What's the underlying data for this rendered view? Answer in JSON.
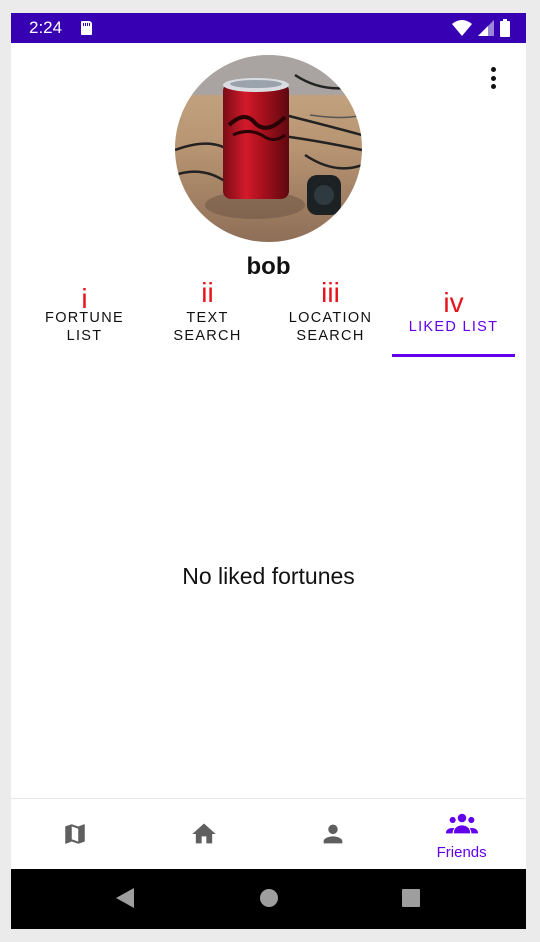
{
  "status_bar": {
    "time": "2:24",
    "icons": [
      "sd-card-icon",
      "wifi-icon",
      "signal-icon",
      "battery-icon"
    ],
    "background": "#3700b3"
  },
  "header": {
    "menu_icon": "more-vert-icon"
  },
  "profile": {
    "name": "bob",
    "avatar": "profile photo of a red soda can on a table"
  },
  "tabs": [
    {
      "marker": "i",
      "label": "FORTUNE\nLIST",
      "active": false
    },
    {
      "marker": "ii",
      "label": "TEXT\nSEARCH",
      "active": false
    },
    {
      "marker": "iii",
      "label": "LOCATION\nSEARCH",
      "active": false
    },
    {
      "marker": "iv",
      "label": "LIKED LIST",
      "active": true
    }
  ],
  "content": {
    "empty_message": "No liked fortunes"
  },
  "bottom_nav": {
    "items": [
      {
        "icon": "map-icon",
        "label": "",
        "active": false
      },
      {
        "icon": "home-icon",
        "label": "",
        "active": false
      },
      {
        "icon": "person-icon",
        "label": "",
        "active": false
      },
      {
        "icon": "group-icon",
        "label": "Friends",
        "active": true
      }
    ]
  },
  "system_nav": {
    "icons": [
      "back-icon",
      "home-circle-icon",
      "recents-icon"
    ]
  },
  "colors": {
    "accent": "#6200ee",
    "status_bar": "#3700b3",
    "marker_red": "#e8121b",
    "inactive_icon": "#5f5f5f"
  }
}
